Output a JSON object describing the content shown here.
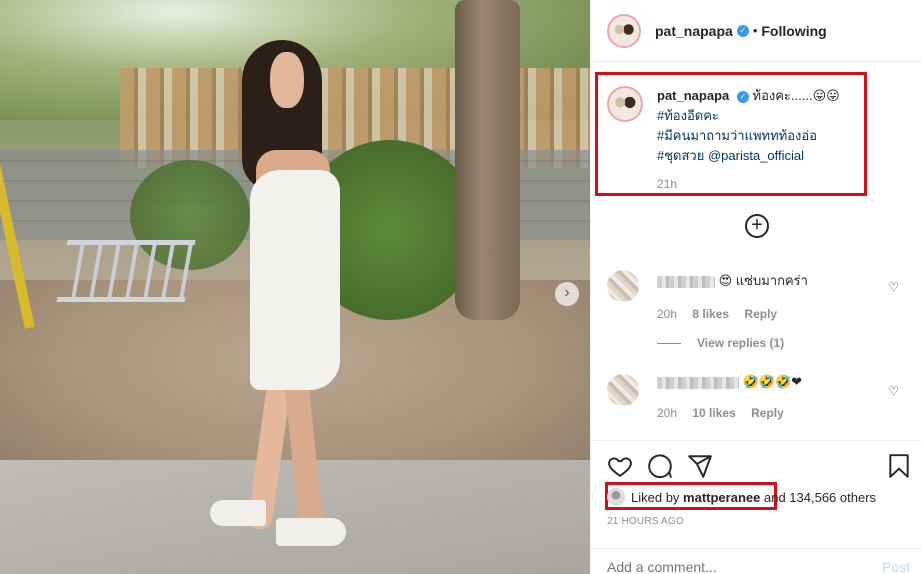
{
  "post": {
    "username": "pat_napapa",
    "follow_state": "Following",
    "separator": "•"
  },
  "caption": {
    "username": "pat_napapa",
    "text": "ท้องคะ......",
    "emojis": "😛😛",
    "lines": [
      "#ท้องอีดคะ",
      "#มีคนมาถามว่าแพททท้องอ่อ",
      "#ชุดสวย"
    ],
    "mention": "@parista_official",
    "time": "21h"
  },
  "comments": [
    {
      "text": "😍 แซ่บมากคร่า",
      "time": "20h",
      "likes": "8 likes",
      "reply": "Reply"
    },
    {
      "text": "🤣🤣🤣❤",
      "time": "20h",
      "likes": "10 likes",
      "reply": "Reply"
    }
  ],
  "view_replies": "View replies (1)",
  "likes": {
    "prefix": "Liked by",
    "user": "mattperanee",
    "rest": "and 134,566 others"
  },
  "posted_ago": "21 HOURS AGO",
  "add_comment": {
    "placeholder": "Add a comment...",
    "post_label": "Post"
  },
  "colors": {
    "highlight": "#d10f1b",
    "verified": "#3897f0",
    "link": "#00376b",
    "muted": "#8e8e8e"
  },
  "icons": {
    "next": "chevron-right-icon",
    "add": "plus-circle-icon",
    "like": "heart-icon",
    "comment": "comment-icon",
    "share": "paper-plane-icon",
    "save": "bookmark-icon"
  }
}
